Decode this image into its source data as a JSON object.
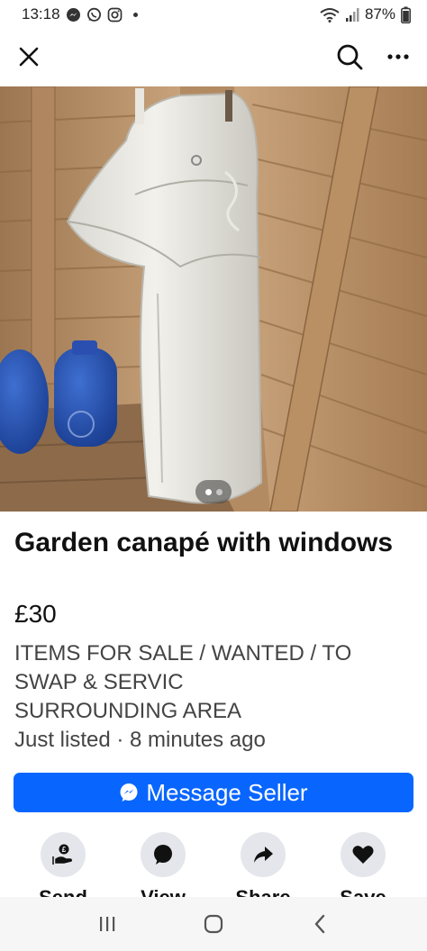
{
  "status_bar": {
    "time": "13:18",
    "battery": "87%",
    "icons": [
      "messenger-icon",
      "whatsapp-icon",
      "instagram-icon",
      "wifi-icon",
      "signal-icon",
      "battery-icon"
    ]
  },
  "top_bar": {
    "icons": [
      "close-icon",
      "search-icon",
      "more-icon"
    ]
  },
  "photo": {
    "page_indicator": {
      "current": 1,
      "total": 2
    }
  },
  "listing": {
    "title": "Garden canapé with windows",
    "price": "£30",
    "group_line1": "ITEMS FOR SALE / WANTED / TO",
    "group_line2": "SWAP & SERVIC",
    "group_line3": "SURROUNDING AREA",
    "listed": "Just listed · 8 minutes ago"
  },
  "message_button": {
    "label": "Message Seller"
  },
  "actions": [
    {
      "label": "Send",
      "icon": "send-offer-icon"
    },
    {
      "label": "View",
      "icon": "chat-bubble-icon"
    },
    {
      "label": "Share",
      "icon": "share-arrow-icon"
    },
    {
      "label": "Save",
      "icon": "heart-icon"
    }
  ],
  "nav": {
    "icons": [
      "recents-icon",
      "home-icon",
      "back-icon"
    ]
  },
  "colors": {
    "accent": "#0866ff",
    "action_bg": "#e4e6eb",
    "nav_bg": "#f6f6f6"
  }
}
